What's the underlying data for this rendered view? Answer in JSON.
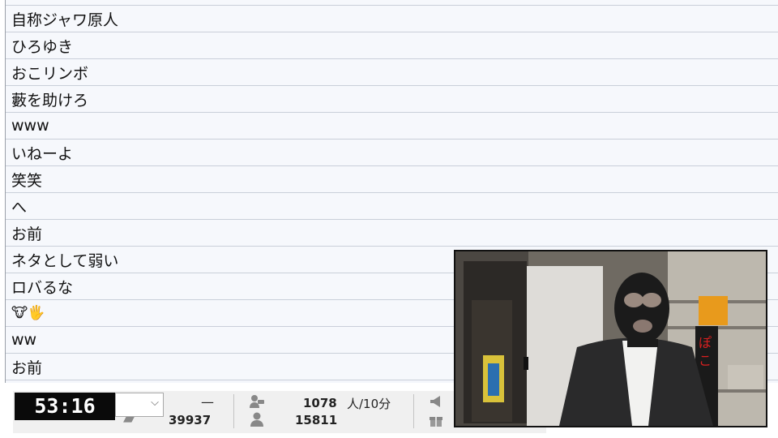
{
  "comments": [
    {
      "text": ""
    },
    {
      "text": "自称ジャワ原人"
    },
    {
      "text": "ひろゆき"
    },
    {
      "text": "おこリンボ"
    },
    {
      "text": "藪を助けろ"
    },
    {
      "text": "www"
    },
    {
      "text": "いねーよ"
    },
    {
      "text": "笑笑"
    },
    {
      "text": "へ"
    },
    {
      "text": "お前"
    },
    {
      "text": "ネタとして弱い"
    },
    {
      "text": "ロバるな"
    },
    {
      "text": "",
      "emoji": "🐮🖐"
    },
    {
      "text": "ww"
    },
    {
      "text": "お前"
    }
  ],
  "status": {
    "timer": "53:16",
    "dash": "—",
    "comment_count": "39937",
    "active_viewers": "1078",
    "active_unit": "人/10分",
    "total_viewers": "15811"
  },
  "icons": [
    "chevron-down-icon",
    "comment-icon",
    "viewer-icon",
    "total-viewer-icon",
    "ad-megaphone-icon",
    "gift-icon"
  ],
  "colors": {
    "timer_bg": "#0a0a0a",
    "row_bg": "#f6f8fc",
    "row_border": "#c9cfd9",
    "status_bg": "#f0f0f0"
  }
}
